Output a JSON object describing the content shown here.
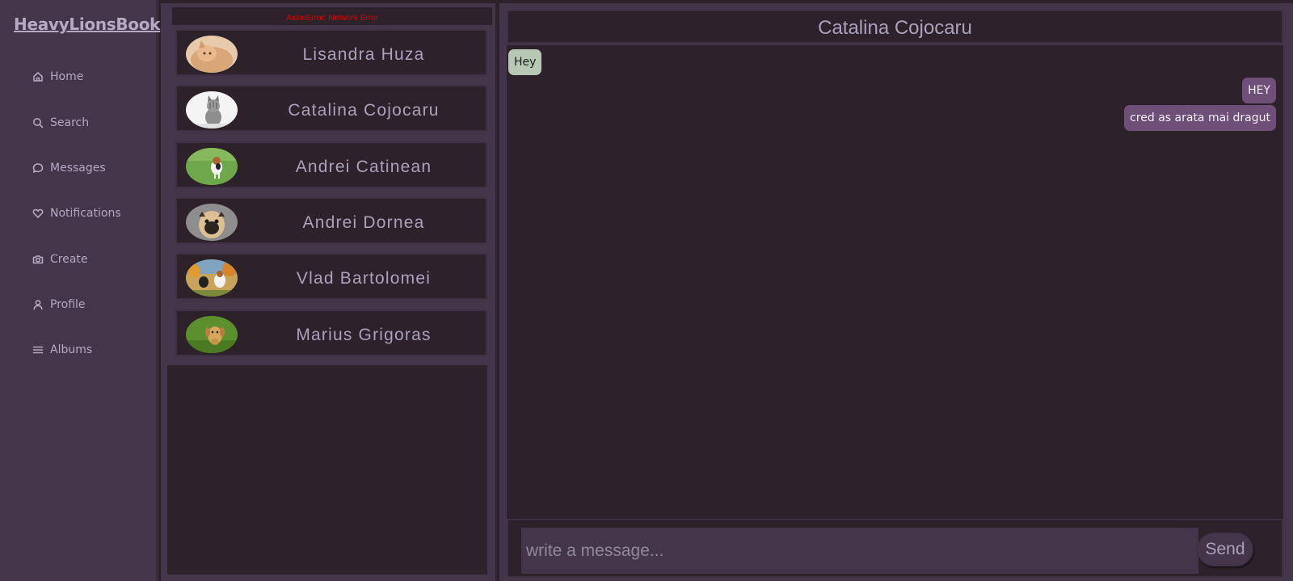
{
  "app": {
    "brand": "HeavyLionsBook"
  },
  "nav": [
    {
      "label": "Home",
      "icon": "home-icon"
    },
    {
      "label": "Search",
      "icon": "search-icon"
    },
    {
      "label": "Messages",
      "icon": "chat-icon"
    },
    {
      "label": "Notifications",
      "icon": "heart-icon"
    },
    {
      "label": "Create",
      "icon": "camera-icon"
    },
    {
      "label": "Profile",
      "icon": "user-icon"
    },
    {
      "label": "Albums",
      "icon": "menu-icon"
    }
  ],
  "conversations": {
    "error": "AxiosError: Network Error",
    "contacts": [
      {
        "name": "Lisandra Huza",
        "avatar": "cat-avatar"
      },
      {
        "name": "Catalina Cojocaru",
        "avatar": "kitten-avatar"
      },
      {
        "name": "Andrei Catinean",
        "avatar": "beagle-avatar"
      },
      {
        "name": "Andrei Dornea",
        "avatar": "pug-avatar"
      },
      {
        "name": "Vlad Bartolomei",
        "avatar": "dogs-avatar"
      },
      {
        "name": "Marius Grigoras",
        "avatar": "labrador-avatar"
      }
    ]
  },
  "chat": {
    "title": "Catalina Cojocaru",
    "messages": [
      {
        "text": "Hey",
        "direction": "incoming"
      },
      {
        "text": "HEY",
        "direction": "outgoing"
      },
      {
        "text": "cred as arata mai dragut",
        "direction": "outgoing"
      }
    ],
    "input_placeholder": "write a message...",
    "send_label": "Send"
  },
  "colors": {
    "sidebar": "#45354b",
    "panel": "#2d2229",
    "text": "#a8a2bd",
    "incoming_bubble": "#b7c9b5",
    "outgoing_bubble": "#6e4f78",
    "error": "#e00000"
  }
}
